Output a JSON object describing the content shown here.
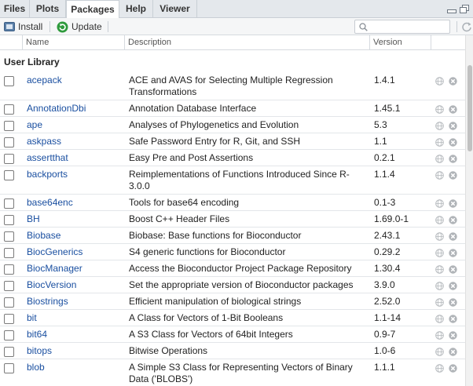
{
  "tabs": [
    {
      "label": "Files"
    },
    {
      "label": "Plots"
    },
    {
      "label": "Packages"
    },
    {
      "label": "Help"
    },
    {
      "label": "Viewer"
    }
  ],
  "toolbar": {
    "install_label": "Install",
    "update_label": "Update",
    "search_value": ""
  },
  "columns": {
    "name": "Name",
    "description": "Description",
    "version": "Version"
  },
  "library": {
    "title": "User Library",
    "packages": [
      {
        "name": "acepack",
        "description": "ACE and AVAS for Selecting Multiple Regression Transformations",
        "version": "1.4.1",
        "checked": false
      },
      {
        "name": "AnnotationDbi",
        "description": "Annotation Database Interface",
        "version": "1.45.1",
        "checked": false
      },
      {
        "name": "ape",
        "description": "Analyses of Phylogenetics and Evolution",
        "version": "5.3",
        "checked": false
      },
      {
        "name": "askpass",
        "description": "Safe Password Entry for R, Git, and SSH",
        "version": "1.1",
        "checked": false
      },
      {
        "name": "assertthat",
        "description": "Easy Pre and Post Assertions",
        "version": "0.2.1",
        "checked": false
      },
      {
        "name": "backports",
        "description": "Reimplementations of Functions Introduced Since R-3.0.0",
        "version": "1.1.4",
        "checked": false
      },
      {
        "name": "base64enc",
        "description": "Tools for base64 encoding",
        "version": "0.1-3",
        "checked": false
      },
      {
        "name": "BH",
        "description": "Boost C++ Header Files",
        "version": "1.69.0-1",
        "checked": false
      },
      {
        "name": "Biobase",
        "description": "Biobase: Base functions for Bioconductor",
        "version": "2.43.1",
        "checked": false
      },
      {
        "name": "BiocGenerics",
        "description": "S4 generic functions for Bioconductor",
        "version": "0.29.2",
        "checked": false
      },
      {
        "name": "BiocManager",
        "description": "Access the Bioconductor Project Package Repository",
        "version": "1.30.4",
        "checked": false
      },
      {
        "name": "BiocVersion",
        "description": "Set the appropriate version of Bioconductor packages",
        "version": "3.9.0",
        "checked": false
      },
      {
        "name": "Biostrings",
        "description": "Efficient manipulation of biological strings",
        "version": "2.52.0",
        "checked": false
      },
      {
        "name": "bit",
        "description": "A Class for Vectors of 1-Bit Booleans",
        "version": "1.1-14",
        "checked": false
      },
      {
        "name": "bit64",
        "description": "A S3 Class for Vectors of 64bit Integers",
        "version": "0.9-7",
        "checked": false
      },
      {
        "name": "bitops",
        "description": "Bitwise Operations",
        "version": "1.0-6",
        "checked": false
      },
      {
        "name": "blob",
        "description": "A Simple S3 Class for Representing Vectors of Binary Data ('BLOBS')",
        "version": "1.1.1",
        "checked": false
      }
    ]
  },
  "icons": {
    "install": "install-icon",
    "update": "update-icon",
    "search": "search-icon",
    "refresh": "refresh-icon",
    "web": "globe-icon",
    "remove": "remove-icon",
    "minimize": "minimize-icon",
    "maximize": "maximize-icon"
  },
  "colors": {
    "package_link": "#1a4fa0",
    "update_green": "#2e9a3c",
    "tabbar_bg": "#e4e8ec"
  }
}
